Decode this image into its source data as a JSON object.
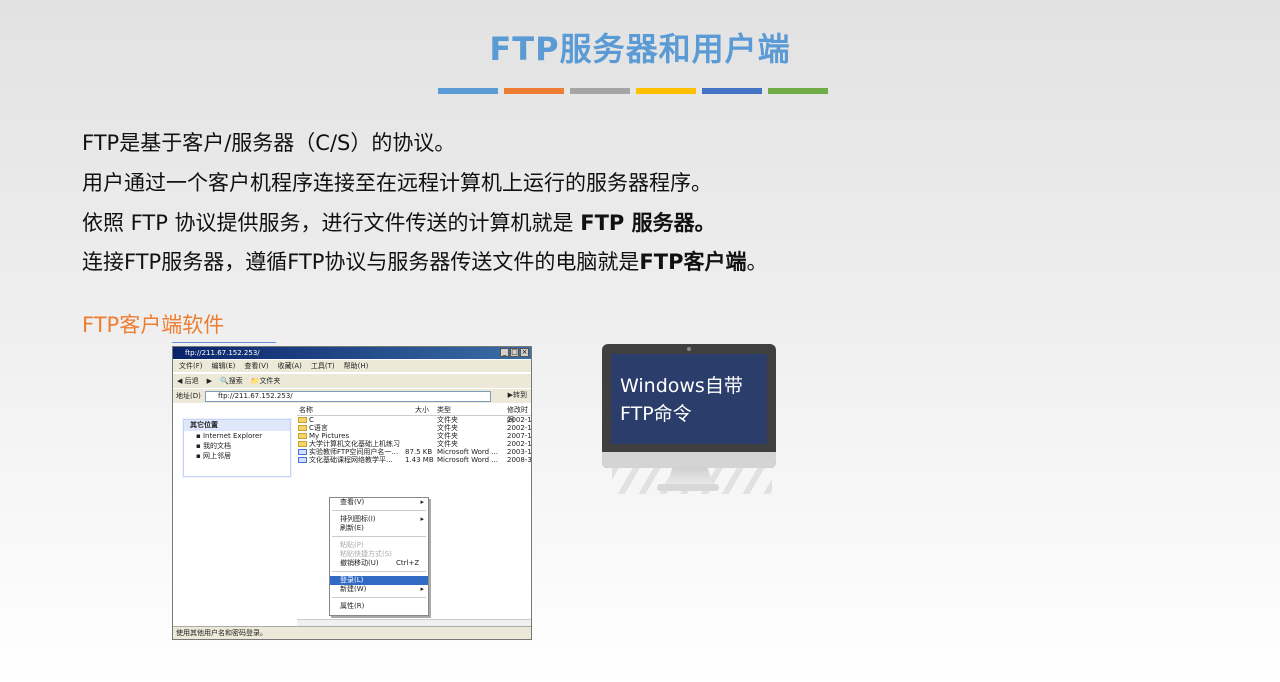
{
  "slide": {
    "title": "FTP服务器和用户端",
    "title_bar_colors": [
      "#5b9bd5",
      "#ed7d31",
      "#a5a5a5",
      "#ffc000",
      "#4472c4",
      "#70ad47"
    ],
    "lines": [
      {
        "text": "FTP是基于客户/服务器（C/S）的协议。"
      },
      {
        "text": "用户通过一个客户机程序连接至在远程计算机上运行的服务器程序。"
      },
      {
        "pre": "依照 FTP 协议提供服务，进行文件传送的计算机就是 ",
        "bold": "FTP 服务器。"
      },
      {
        "pre": "连接FTP服务器，遵循FTP协议与服务器传送文件的电脑就是",
        "bold": "FTP客户端",
        "post": "。"
      }
    ],
    "subheading": "FTP客户端软件",
    "subheading_color": "#ed7d31"
  },
  "explorer": {
    "title": "ftp://211.67.152.253/",
    "menu": [
      "文件(F)",
      "编辑(E)",
      "查看(V)",
      "收藏(A)",
      "工具(T)",
      "帮助(H)"
    ],
    "toolbar": [
      "后退",
      "搜索",
      "文件夹"
    ],
    "address_label": "地址(D)",
    "address": "ftp://211.67.152.253/",
    "go": "转到",
    "panel_title": "其它位置",
    "panel_items": [
      "Internet Explorer",
      "我的文档",
      "网上邻居"
    ],
    "columns": {
      "name": "名称",
      "size": "大小",
      "type": "类型",
      "date": "修改时间"
    },
    "rows": [
      {
        "name": "C",
        "size": "",
        "type": "文件夹",
        "date": "2002-1",
        "icon": "folder-icon"
      },
      {
        "name": "C语言",
        "size": "",
        "type": "文件夹",
        "date": "2002-1",
        "icon": "folder-icon"
      },
      {
        "name": "My Pictures",
        "size": "",
        "type": "文件夹",
        "date": "2007-1",
        "icon": "folder-icon"
      },
      {
        "name": "大学计算机文化基础上机练习",
        "size": "",
        "type": "文件夹",
        "date": "2002-1",
        "icon": "folder-icon"
      },
      {
        "name": "实验教师FTP空间用户名一...",
        "size": "87.5 KB",
        "type": "Microsoft Word ...",
        "date": "2003-1",
        "icon": "word-doc-icon"
      },
      {
        "name": "文化基础课程网络教学平...",
        "size": "1.43 MB",
        "type": "Microsoft Word ...",
        "date": "2008-3",
        "icon": "word-doc-icon"
      }
    ],
    "context_menu": [
      {
        "label": "查看(V)",
        "arrow": true
      },
      {
        "sep": true
      },
      {
        "label": "排列图标(I)",
        "arrow": true
      },
      {
        "label": "刷新(E)"
      },
      {
        "sep": true
      },
      {
        "label": "粘贴(P)",
        "disabled": true
      },
      {
        "label": "粘贴快捷方式(S)",
        "disabled": true
      },
      {
        "label": "撤销移动(U)",
        "shortcut": "Ctrl+Z"
      },
      {
        "sep": true
      },
      {
        "label": "登录(L)",
        "highlight": true
      },
      {
        "label": "新建(W)",
        "arrow": true
      },
      {
        "sep": true
      },
      {
        "label": "属性(R)"
      }
    ],
    "status": "使用其他用户名和密码登录。"
  },
  "monitor": {
    "screen_text": "Windows自带FTP命令",
    "screen_color": "#2b3e6b"
  }
}
